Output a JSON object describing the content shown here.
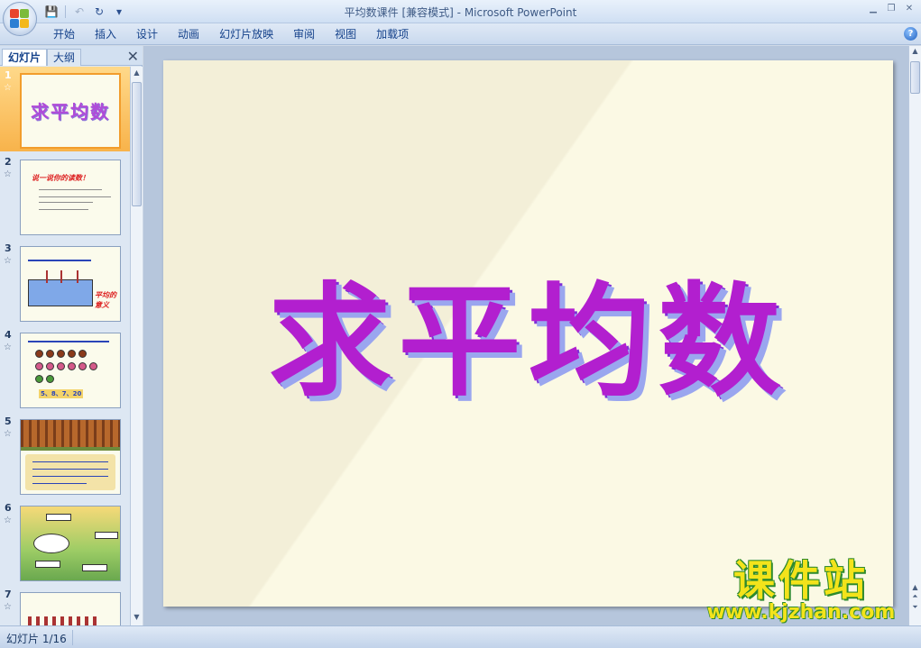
{
  "window": {
    "title": "平均数课件 [兼容模式]",
    "title_sep": " - ",
    "app_name": "Microsoft PowerPoint"
  },
  "qat": {
    "save_icon": "save-icon",
    "undo_icon": "undo-icon",
    "redo_icon": "redo-icon"
  },
  "ribbon": {
    "tabs": [
      "开始",
      "插入",
      "设计",
      "动画",
      "幻灯片放映",
      "审阅",
      "视图",
      "加载项"
    ]
  },
  "panel": {
    "tab_slides": "幻灯片",
    "tab_outline": "大纲",
    "close": "✕"
  },
  "thumbnails": [
    {
      "num": "1",
      "title": "求平均数"
    },
    {
      "num": "2",
      "heading": "说一说你的读数！"
    },
    {
      "num": "3",
      "label": "平均的意义"
    },
    {
      "num": "4",
      "label": "5、8、7、20"
    },
    {
      "num": "5"
    },
    {
      "num": "6"
    },
    {
      "num": "7"
    }
  ],
  "slide": {
    "title": "求平均数"
  },
  "watermark": {
    "brand": "课件站",
    "url": "www.kjzhan.com"
  },
  "status": {
    "slide_indicator": "幻灯片 1/16"
  },
  "colors": {
    "title_fill": "#b21fcf",
    "title_shadow": "#9aa6ef",
    "selected_thumb": "#f8b34b"
  }
}
